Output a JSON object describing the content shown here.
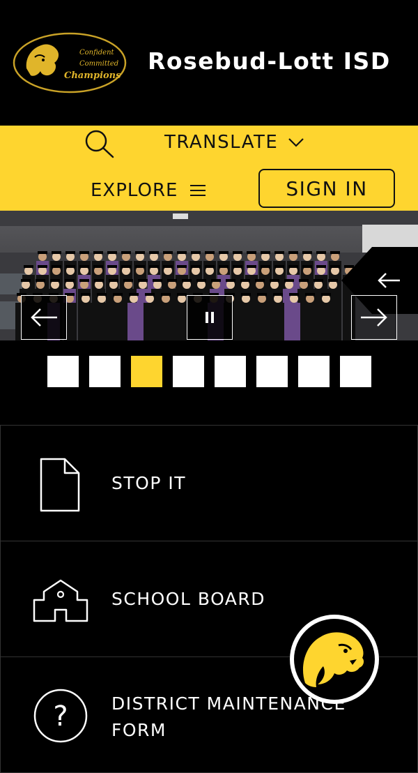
{
  "header": {
    "title": "Rosebud-Lott ISD",
    "logo_text": [
      "Confident",
      "Committed",
      "Champions"
    ]
  },
  "toolbar": {
    "translate_label": "TRANSLATE",
    "explore_label": "EXPLORE",
    "signin_label": "SIGN IN"
  },
  "slideshow": {
    "slide_count": 8,
    "active_slide": 3
  },
  "quick_links": [
    {
      "label": "STOP IT",
      "icon": "document-icon"
    },
    {
      "label": "SCHOOL BOARD",
      "icon": "school-building-icon"
    },
    {
      "label": "DISTRICT MAINTENANCE FORM",
      "icon": "question-circle-icon"
    }
  ],
  "colors": {
    "brand_yellow": "#fed52f",
    "background": "#000000",
    "text": "#ffffff"
  }
}
